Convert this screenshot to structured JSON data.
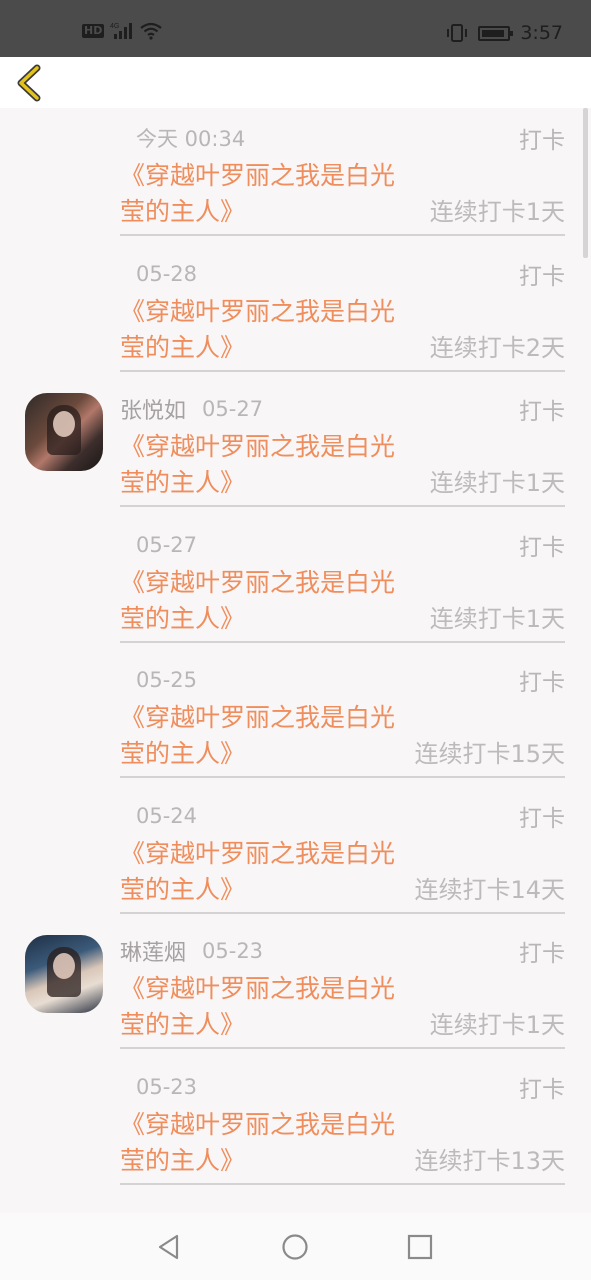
{
  "status_bar": {
    "left_icons": [
      "hd-icon",
      "4g-signal-icon",
      "wifi-icon"
    ],
    "hd_label": "HD",
    "network_label": "4G",
    "time": "3:57",
    "battery_level": 0.9
  },
  "header": {
    "back_icon": "chevron-left-icon",
    "accent_color": "#e2c31c"
  },
  "feed": {
    "items": [
      {
        "user": "",
        "date": "今天 00:34",
        "action": "打卡",
        "book": "《穿越叶罗丽之我是白光莹的主人》",
        "streak": "连续打卡1天",
        "avatar": false
      },
      {
        "user": "",
        "date": "05-28",
        "action": "打卡",
        "book": "《穿越叶罗丽之我是白光莹的主人》",
        "streak": "连续打卡2天",
        "avatar": false
      },
      {
        "user": "张悦如",
        "date": "05-27",
        "action": "打卡",
        "book": "《穿越叶罗丽之我是白光莹的主人》",
        "streak": "连续打卡1天",
        "avatar": true
      },
      {
        "user": "",
        "date": "05-27",
        "action": "打卡",
        "book": "《穿越叶罗丽之我是白光莹的主人》",
        "streak": "连续打卡1天",
        "avatar": false
      },
      {
        "user": "",
        "date": "05-25",
        "action": "打卡",
        "book": "《穿越叶罗丽之我是白光莹的主人》",
        "streak": "连续打卡15天",
        "avatar": false
      },
      {
        "user": "",
        "date": "05-24",
        "action": "打卡",
        "book": "《穿越叶罗丽之我是白光莹的主人》",
        "streak": "连续打卡14天",
        "avatar": false
      },
      {
        "user": "琳莲烟",
        "date": "05-23",
        "action": "打卡",
        "book": "《穿越叶罗丽之我是白光莹的主人》",
        "streak": "连续打卡1天",
        "avatar": true
      },
      {
        "user": "",
        "date": "05-23",
        "action": "打卡",
        "book": "《穿越叶罗丽之我是白光莹的主人》",
        "streak": "连续打卡13天",
        "avatar": false
      }
    ]
  },
  "nav_bar": {
    "buttons": [
      "back-triangle-icon",
      "home-circle-icon",
      "recents-square-icon"
    ]
  },
  "colors": {
    "book_title": "#ef8e5c",
    "muted_text": "#b9b6b7",
    "background": "#f8f6f7"
  }
}
